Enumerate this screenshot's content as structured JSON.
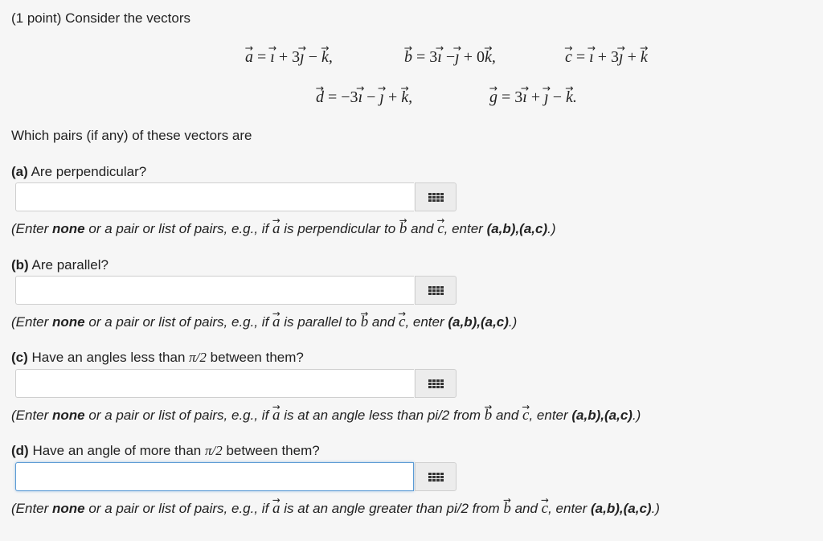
{
  "problem": {
    "intro": "(1 point) Consider the vectors",
    "which": "Which pairs (if any) of these vectors are"
  },
  "vectors": {
    "a": "a = i + 3j − k,",
    "b": "b = 3i − j + 0k,",
    "c": "c = i + 3j + k",
    "d": "d = −3i − j + k,",
    "g": "g = 3i + j − k."
  },
  "parts": [
    {
      "letter": "(a)",
      "question": "Are perpendicular?",
      "answer_value": "",
      "hint_pre": "(Enter ",
      "hint_bold": "none",
      "hint_mid": " or a pair or list of pairs, e.g., if ",
      "hint_relation": " is perpendicular to ",
      "hint_and": " and ",
      "hint_enter": ", enter ",
      "hint_example": "(a,b),(a,c)",
      "hint_end": ".)"
    },
    {
      "letter": "(b)",
      "question": "Are parallel?",
      "answer_value": "",
      "hint_pre": "(Enter ",
      "hint_bold": "none",
      "hint_mid": " or a pair or list of pairs, e.g., if ",
      "hint_relation": " is parallel to ",
      "hint_and": " and ",
      "hint_enter": ", enter ",
      "hint_example": "(a,b),(a,c)",
      "hint_end": ".)"
    },
    {
      "letter": "(c)",
      "question_pre": "Have an angles less than ",
      "question_pi": "π/2",
      "question_post": " between them?",
      "answer_value": "",
      "hint_pre": "(Enter ",
      "hint_bold": "none",
      "hint_mid": " or a pair or list of pairs, e.g., if ",
      "hint_relation": " is at an angle less than pi/2 from ",
      "hint_and": " and ",
      "hint_enter": ", enter ",
      "hint_example": "(a,b),(a,c)",
      "hint_end": ".)"
    },
    {
      "letter": "(d)",
      "question_pre": "Have an angle of more than ",
      "question_pi": "π/2",
      "question_post": " between them?",
      "answer_value": "",
      "hint_pre": "(Enter ",
      "hint_bold": "none",
      "hint_mid": " or a pair or list of pairs, e.g., if ",
      "hint_relation": " is at an angle greater than pi/2 from ",
      "hint_and": " and ",
      "hint_enter": ", enter ",
      "hint_example": "(a,b),(a,c)",
      "hint_end": ".)"
    }
  ],
  "hint_symbols": {
    "a": "a",
    "b": "b",
    "c": "c"
  },
  "icons": {
    "palette": "grid-icon"
  },
  "colors": {
    "focus_border": "#5b9bd5",
    "background": "#f6f6f6"
  }
}
